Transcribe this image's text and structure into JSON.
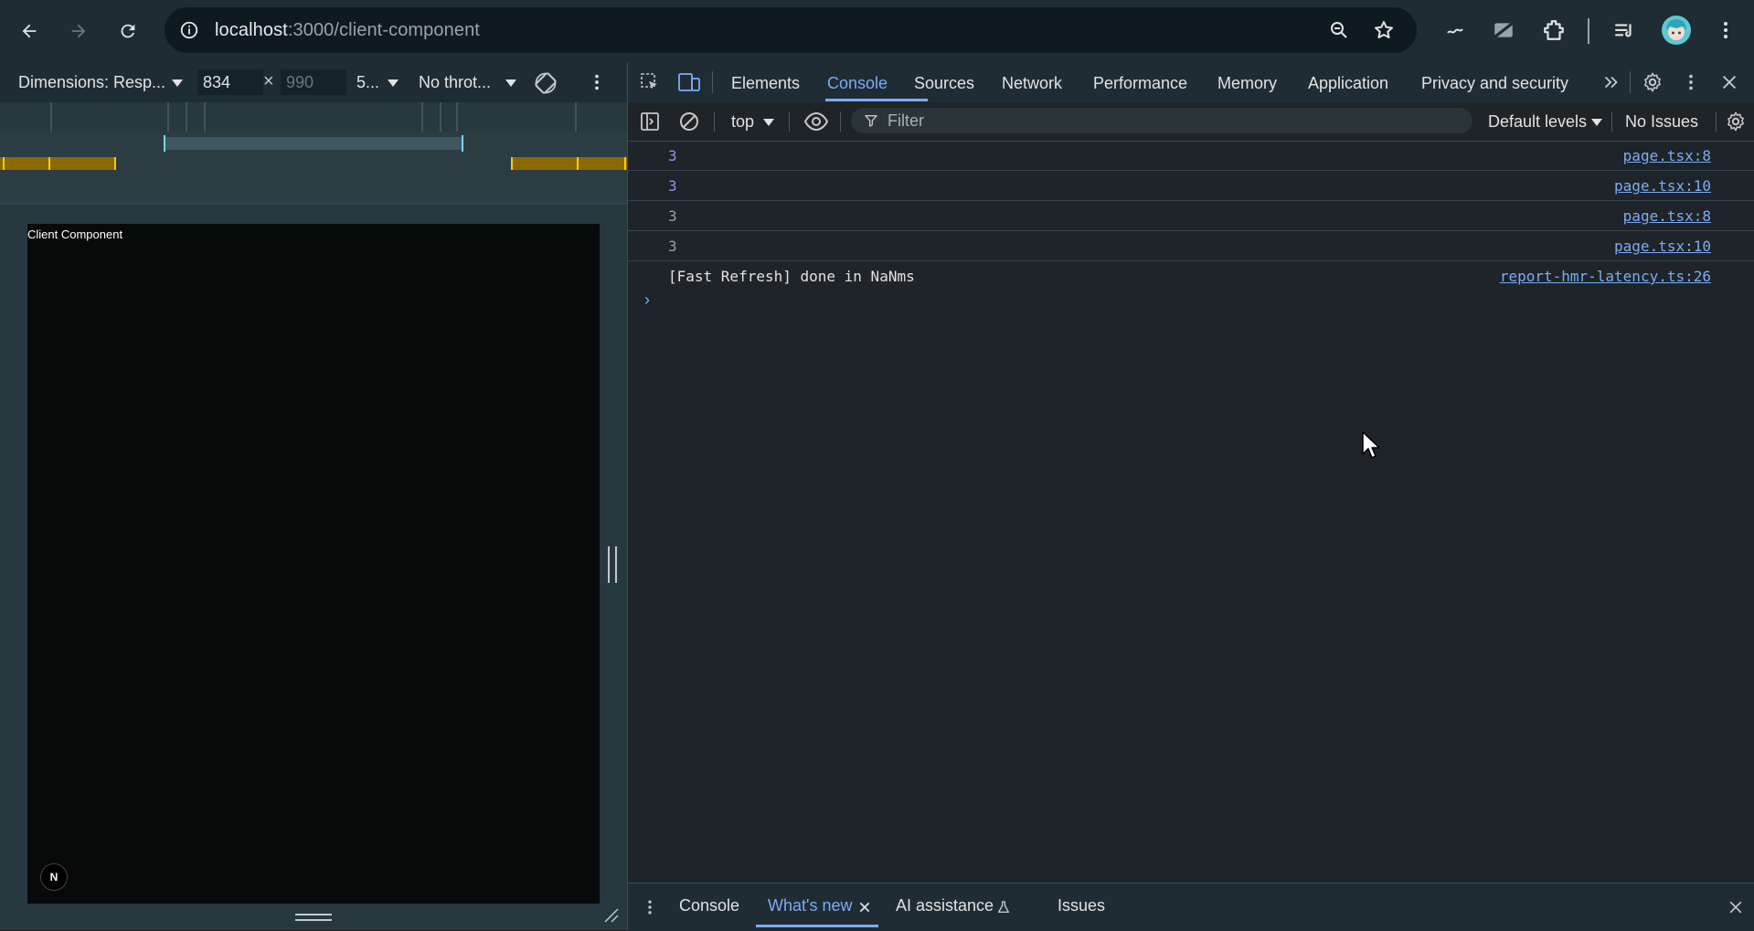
{
  "browser": {
    "url_host": "localhost",
    "url_path": ":3000/client-component"
  },
  "device_toolbar": {
    "dimensions_label": "Dimensions: Resp...",
    "width": "834",
    "times": "×",
    "height": "990",
    "zoom": "5...",
    "throttle": "No throt..."
  },
  "viewport": {
    "text": "Client Component",
    "badge": "N"
  },
  "devtools": {
    "tabs": [
      "Elements",
      "Console",
      "Sources",
      "Network",
      "Performance",
      "Memory",
      "Application",
      "Privacy and security"
    ],
    "active_tab": "Console",
    "console_toolbar": {
      "context": "top",
      "filter_placeholder": "Filter",
      "levels": "Default levels",
      "issues": "No Issues"
    },
    "log": [
      {
        "message": "3",
        "source": "page.tsx:8"
      },
      {
        "message": "3",
        "source": "page.tsx:10"
      },
      {
        "message": "3",
        "source": "page.tsx:8"
      },
      {
        "message": "3",
        "source": "page.tsx:10"
      },
      {
        "message": "[Fast Refresh] done in NaNms",
        "source": "report-hmr-latency.ts:26"
      }
    ],
    "prompt": "›",
    "drawer": {
      "tabs": [
        "Console",
        "What's new",
        "AI assistance",
        "Issues"
      ],
      "active_tab": "What's new"
    }
  },
  "colors": {
    "accent": "#7cacf8",
    "media_query_orange": "#8a6a00",
    "media_query_yellow": "#ffcc00"
  }
}
